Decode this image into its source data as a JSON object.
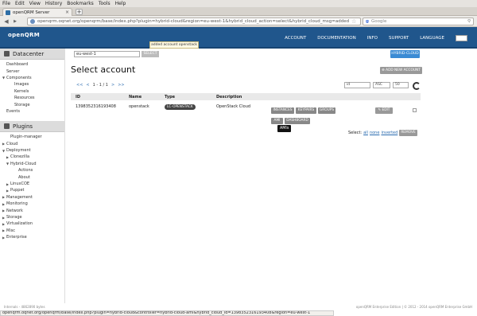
{
  "browser": {
    "menu": [
      "File",
      "Edit",
      "View",
      "History",
      "Bookmarks",
      "Tools",
      "Help"
    ],
    "tab_title": "openQRM Server",
    "url": "openqrm.oqnet.org/openqrm/base/index.php?plugin=hybrid-cloud&region=eu-west-1&hybrid_cloud_action=select&hybrid_cloud_msg=added",
    "search_placeholder": "Google",
    "status_url": "openqrm.oqnet.org/openqrm/base/index.php?plugin=hybrid-cloud&controller=hybrid-cloud-ami&hybrid_cloud_id=1398352316193408&region=eu-west-1"
  },
  "header": {
    "logo_text": "openQRM",
    "nav": [
      "ACCOUNT",
      "DOCUMENTATION",
      "INFO",
      "SUPPORT"
    ],
    "language_label": "LANGUAGE",
    "language_value": "en"
  },
  "sidebar": {
    "datacenter_title": "Datacenter",
    "datacenter_items": [
      {
        "label": "Dashboard",
        "indent": 0,
        "arrow": ""
      },
      {
        "label": "Server",
        "indent": 0,
        "arrow": ""
      },
      {
        "label": "Components",
        "indent": 0,
        "arrow": "▼"
      },
      {
        "label": "Images",
        "indent": 2,
        "arrow": ""
      },
      {
        "label": "Kernels",
        "indent": 2,
        "arrow": ""
      },
      {
        "label": "Resources",
        "indent": 2,
        "arrow": ""
      },
      {
        "label": "Storage",
        "indent": 2,
        "arrow": ""
      },
      {
        "label": "Events",
        "indent": 0,
        "arrow": ""
      }
    ],
    "plugins_title": "Plugins",
    "plugin_items": [
      {
        "label": "Plugin-manager",
        "indent": 1,
        "arrow": ""
      },
      {
        "label": "Cloud",
        "indent": 0,
        "arrow": "▶"
      },
      {
        "label": "Deployment",
        "indent": 0,
        "arrow": "▼"
      },
      {
        "label": "Clonezilla",
        "indent": 1,
        "arrow": "▶"
      },
      {
        "label": "Hybrid-Cloud",
        "indent": 1,
        "arrow": "▼"
      },
      {
        "label": "Actions",
        "indent": 3,
        "arrow": ""
      },
      {
        "label": "About",
        "indent": 3,
        "arrow": ""
      },
      {
        "label": "LinuxCOE",
        "indent": 1,
        "arrow": "▶"
      },
      {
        "label": "Puppet",
        "indent": 1,
        "arrow": "▶"
      },
      {
        "label": "Management",
        "indent": 0,
        "arrow": "▶"
      },
      {
        "label": "Monitoring",
        "indent": 0,
        "arrow": "▶"
      },
      {
        "label": "Network",
        "indent": 0,
        "arrow": "▶"
      },
      {
        "label": "Storage",
        "indent": 0,
        "arrow": "▶"
      },
      {
        "label": "Virtualization",
        "indent": 0,
        "arrow": "▶"
      },
      {
        "label": "Misc",
        "indent": 0,
        "arrow": "▶"
      },
      {
        "label": "Enterprise",
        "indent": 0,
        "arrow": "▶"
      }
    ]
  },
  "main": {
    "notice": "added account openstack",
    "region_select": "eu-west-1",
    "select_button": "SELECT",
    "hybrid_cloud_button": "HYBRID-CLOUD",
    "title": "Select account",
    "add_button": "ADD NEW ACCOUNT",
    "pager": {
      "first": "<<",
      "prev": "<",
      "current": "1 - 1 / 1",
      "next": ">",
      "last": ">>"
    },
    "sort_select": "id",
    "order_select": "ASC",
    "limit_select": "50",
    "columns": [
      "ID",
      "Name",
      "Type",
      "Description"
    ],
    "row": {
      "id": "1398352316193408",
      "name": "openstack",
      "type": "LC-OPENSTACK",
      "description": "OpenStack Cloud",
      "buttons": [
        "INSTANCES",
        "KEYPAIRS",
        "GROUPS",
        "AMI",
        "DASHBOARD"
      ],
      "edit": "EDIT"
    },
    "tooltip": "AMIs",
    "select_label": "Select:",
    "select_all": "all",
    "select_none": "none",
    "select_inverted": "inverted",
    "remove_button": "REMOVE"
  },
  "footer": {
    "left": "Internals - 4862890 bytes",
    "right": "openQRM Enterprise Edition | © 2012 - 2014 openQRM Enterprise GmbH"
  }
}
